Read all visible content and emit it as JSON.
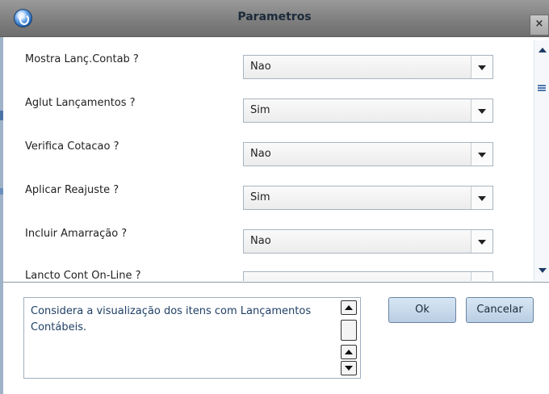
{
  "window": {
    "title": "Parametros",
    "close_label": "×"
  },
  "params": [
    {
      "label": "Mostra Lanç.Contab ?",
      "value": "Nao"
    },
    {
      "label": "Aglut Lançamentos ?",
      "value": "Sim"
    },
    {
      "label": "Verifica Cotacao ?",
      "value": "Nao"
    },
    {
      "label": "Aplicar Reajuste ?",
      "value": "Sim"
    },
    {
      "label": "Incluir Amarração ?",
      "value": "Nao"
    },
    {
      "label": "Lancto Cont On-Line ?",
      "value": ""
    }
  ],
  "help": {
    "text": "Considera a visualização dos itens com Lançamentos Contábeis."
  },
  "buttons": {
    "ok": "Ok",
    "cancel": "Cancelar"
  }
}
